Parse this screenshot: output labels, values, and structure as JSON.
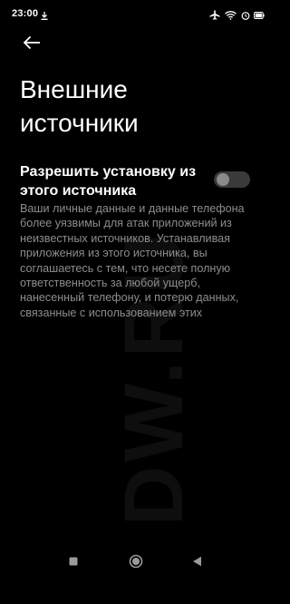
{
  "status_bar": {
    "time": "23:00",
    "icons": [
      "download-icon",
      "airplane-mode-icon",
      "wifi-icon",
      "alarm-icon",
      "battery-icon"
    ]
  },
  "header": {
    "back_icon": "arrow-left-icon",
    "title": "Внешние источники"
  },
  "setting": {
    "label": "Разрешить установку из этого источника",
    "enabled": false
  },
  "warning": {
    "text": "Ваши личные данные и данные телефона более уязвимы для атак приложений из неизвестных источников. Устанавливая приложения из этого источника, вы соглашаетесь с тем, что несете полную ответственность за любой ущерб, нанесенный телефону, и потерю данных, связанные с использованием этих"
  },
  "watermark": {
    "text": "DW.RU"
  },
  "nav_bar": {
    "icons": [
      "recents-icon",
      "home-icon",
      "back-triangle-icon"
    ]
  },
  "colors": {
    "background": "#000000",
    "title": "#ffffff",
    "body_text": "#8d8d8d",
    "toggle_track": "#3a3a3a",
    "toggle_knob": "#8a8a8a"
  }
}
